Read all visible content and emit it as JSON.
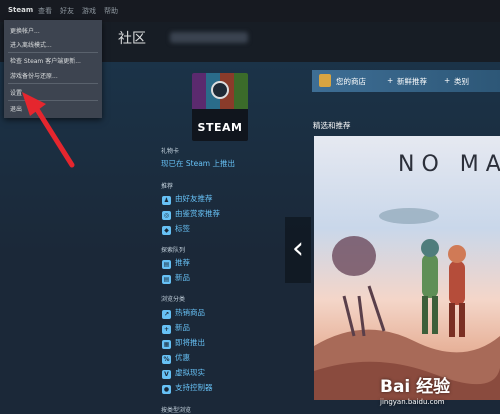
{
  "top_menu": [
    "Steam",
    "查看",
    "好友",
    "游戏",
    "帮助"
  ],
  "dropdown": {
    "items": [
      "更换帐户...",
      "进入离线模式...",
      "检查 Steam 客户端更新...",
      "游戏备份与还原...",
      "设置",
      "退出"
    ]
  },
  "nav": {
    "title": "社区"
  },
  "gift_card": {
    "brand": "STEAM",
    "section": "礼物卡",
    "link": "现已在 Steam 上推出"
  },
  "sidebar": {
    "recommended": {
      "heading": "推荐",
      "items": [
        "由好友推荐",
        "由鉴赏家推荐",
        "标签"
      ]
    },
    "queue": {
      "heading": "探索队列",
      "items": [
        "推荐",
        "新品"
      ]
    },
    "browse": {
      "heading": "浏览分类",
      "items": [
        "热销商品",
        "新品",
        "即将推出",
        "优惠",
        "虚拟现实",
        "支持控制器"
      ]
    },
    "more_heading": "按类型浏览"
  },
  "store_nav": {
    "items": [
      "您的商店",
      "新鲜推荐",
      "类别"
    ]
  },
  "featured": {
    "label": "精选和推荐",
    "banner_title": "NO MA",
    "prev_icon": "chevron-left-icon"
  },
  "watermark": {
    "main": "Bai 经验",
    "sub": "jingyan.baidu.com"
  },
  "colors": {
    "accent": "#67c1f5",
    "background": "#1b2838",
    "store_nav": "#3e6e95",
    "arrow": "#e5262e"
  }
}
